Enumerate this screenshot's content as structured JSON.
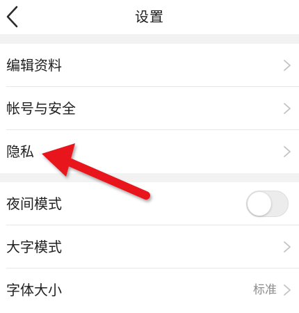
{
  "header": {
    "title": "设置",
    "back_icon": "chevron-left-icon"
  },
  "groups": [
    {
      "items": [
        {
          "label": "编辑资料",
          "control": "chevron"
        },
        {
          "label": "帐号与安全",
          "control": "chevron"
        },
        {
          "label": "隐私",
          "control": "chevron"
        }
      ]
    },
    {
      "items": [
        {
          "label": "夜间模式",
          "control": "toggle",
          "toggle_on": false
        },
        {
          "label": "大字模式",
          "control": "chevron"
        },
        {
          "label": "字体大小",
          "control": "chevron",
          "value": "标准"
        }
      ]
    }
  ],
  "colors": {
    "background": "#ffffff",
    "separator": "#f2f2f2",
    "divider": "#e6e6e6",
    "chevron": "#c2c2c2",
    "annotation_arrow": "#e8141b"
  }
}
